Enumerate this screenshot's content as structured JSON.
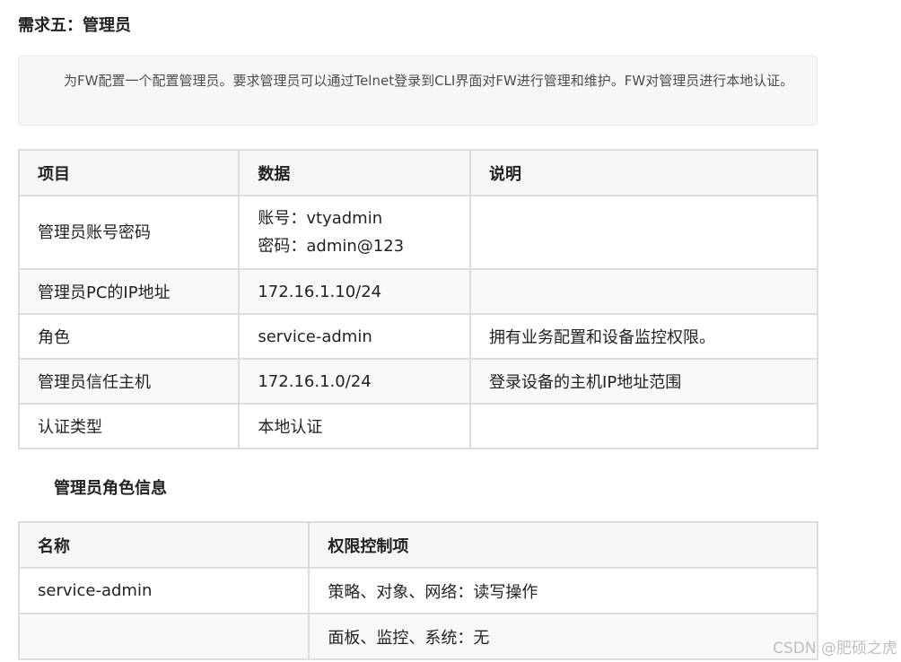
{
  "heading": "需求五：管理员",
  "note": "为FW配置一个配置管理员。要求管理员可以通过Telnet登录到CLI界面对FW进行管理和维护。FW对管理员进行本地认证。",
  "table1": {
    "headers": [
      "项目",
      "数据",
      "说明"
    ],
    "rows": [
      {
        "item": "管理员账号密码",
        "data_line1": "账号：vtyadmin",
        "data_line2": "密码：admin@123",
        "desc": ""
      },
      {
        "item": "管理员PC的IP地址",
        "data": "172.16.1.10/24",
        "desc": ""
      },
      {
        "item": "角色",
        "data": "service-admin",
        "desc": "拥有业务配置和设备监控权限。"
      },
      {
        "item": "管理员信任主机",
        "data": "172.16.1.0/24",
        "desc": "登录设备的主机IP地址范围"
      },
      {
        "item": "认证类型",
        "data": "本地认证",
        "desc": ""
      }
    ]
  },
  "sub_heading": "管理员角色信息",
  "table2": {
    "headers": [
      "名称",
      "权限控制项"
    ],
    "rows": [
      {
        "name": "service-admin",
        "perm": "策略、对象、网络：读写操作"
      },
      {
        "name": "",
        "perm": "面板、监控、系统：无"
      }
    ]
  },
  "watermark": "CSDN @肥硕之虎"
}
